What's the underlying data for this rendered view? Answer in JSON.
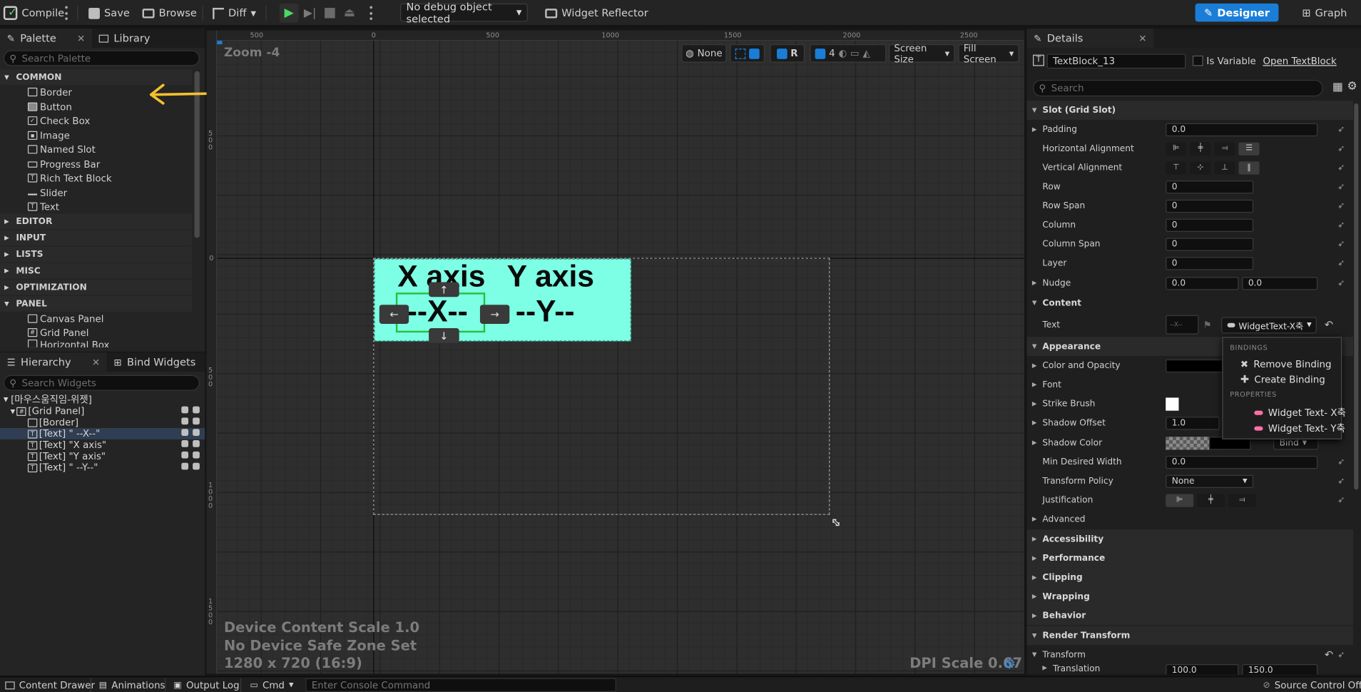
{
  "toolbar": {
    "compile": "Compile",
    "save": "Save",
    "browse": "Browse",
    "diff": "Diff",
    "debug_object": "No debug object selected",
    "widget_reflector": "Widget Reflector",
    "designer": "Designer",
    "graph": "Graph"
  },
  "palette": {
    "tab_palette": "Palette",
    "tab_library": "Library",
    "search_placeholder": "Search Palette",
    "common_label": "COMMON",
    "common_items": [
      "Border",
      "Button",
      "Check Box",
      "Image",
      "Named Slot",
      "Progress Bar",
      "Rich Text Block",
      "Slider",
      "Text"
    ],
    "categories": [
      "EDITOR",
      "INPUT",
      "LISTS",
      "MISC",
      "OPTIMIZATION",
      "PANEL"
    ],
    "panel_items": [
      "Canvas Panel",
      "Grid Panel",
      "Horizontal Box"
    ]
  },
  "hierarchy": {
    "tab_hierarchy": "Hierarchy",
    "tab_bind": "Bind Widgets",
    "search_placeholder": "Search Widgets",
    "root": "[마우스움직임-위젯]",
    "grid": "[Grid Panel]",
    "children": [
      "[Border]",
      "[Text] \" --X--\"",
      "[Text] \"X axis\"",
      "[Text] \"Y axis\"",
      "[Text] \" --Y--\""
    ]
  },
  "viewport": {
    "zoom": "Zoom -4",
    "ruler_h": [
      "500",
      "0",
      "500",
      "1000",
      "1500",
      "2000",
      "2500"
    ],
    "ruler_v": [
      "500",
      "0",
      "500",
      "1000",
      "1500"
    ],
    "none_label": "None",
    "r_label": "R",
    "grid_count": "4",
    "screen_size": "Screen Size",
    "fill_screen": "Fill Screen",
    "device_scale": "Device Content Scale 1.0",
    "safe_zone": "No Device Safe Zone Set",
    "resolution": "1280 x 720 (16:9)",
    "dpi": "DPI Scale 0.67",
    "x_axis": "X axis",
    "y_axis": "Y axis",
    "x_val": "--X--",
    "y_val": "--Y--",
    "arrow_up": "↑",
    "arrow_down": "↓",
    "arrow_left": "←",
    "arrow_right": "→",
    "canvas_color": "#7dffe5"
  },
  "details": {
    "tab": "Details",
    "widget_name": "TextBlock_13",
    "is_variable": "Is Variable",
    "open_link": "Open TextBlock",
    "search_placeholder": "Search",
    "slot_section": "Slot (Grid Slot)",
    "padding_label": "Padding",
    "padding_value": "0.0",
    "halign_label": "Horizontal Alignment",
    "valign_label": "Vertical Alignment",
    "row_label": "Row",
    "row_value": "0",
    "rowspan_label": "Row Span",
    "rowspan_value": "0",
    "column_label": "Column",
    "column_value": "0",
    "colspan_label": "Column Span",
    "colspan_value": "0",
    "layer_label": "Layer",
    "layer_value": "0",
    "nudge_label": "Nudge",
    "nudge_x": "0.0",
    "nudge_y": "0.0",
    "content_section": "Content",
    "text_label": "Text",
    "text_preview": "--X--",
    "binding_value": "WidgetText-X축",
    "appearance_section": "Appearance",
    "color_label": "Color and Opacity",
    "font_label": "Font",
    "strike_label": "Strike Brush",
    "shadow_offset_label": "Shadow Offset",
    "shadow_offset_value": "1.0",
    "shadow_color_label": "Shadow Color",
    "bind_label": "Bind",
    "min_width_label": "Min Desired Width",
    "min_width_value": "0.0",
    "transform_policy_label": "Transform Policy",
    "transform_policy_value": "None",
    "justification_label": "Justification",
    "advanced": "Advanced",
    "sections": [
      "Accessibility",
      "Performance",
      "Clipping",
      "Wrapping",
      "Behavior",
      "Render Transform"
    ],
    "transform_label": "Transform",
    "translation_label": "Translation",
    "translation_x": "100.0",
    "translation_y": "150.0"
  },
  "binding_popup": {
    "header_bindings": "BINDINGS",
    "remove": "Remove Binding",
    "create": "Create Binding",
    "header_properties": "PROPERTIES",
    "prop_x": "Widget Text- X축",
    "prop_y": "Widget Text- Y축"
  },
  "bottom": {
    "content_drawer": "Content Drawer",
    "animations": "Animations",
    "output_log": "Output Log",
    "cmd": "Cmd",
    "console_placeholder": "Enter Console Command",
    "source_control": "Source Control Off"
  },
  "colors": {
    "accent": "#1a7ed8",
    "canvas": "#7dffe5",
    "arrow_annotation": "#f2c12e",
    "binding_pink": "#ff6fa5"
  }
}
